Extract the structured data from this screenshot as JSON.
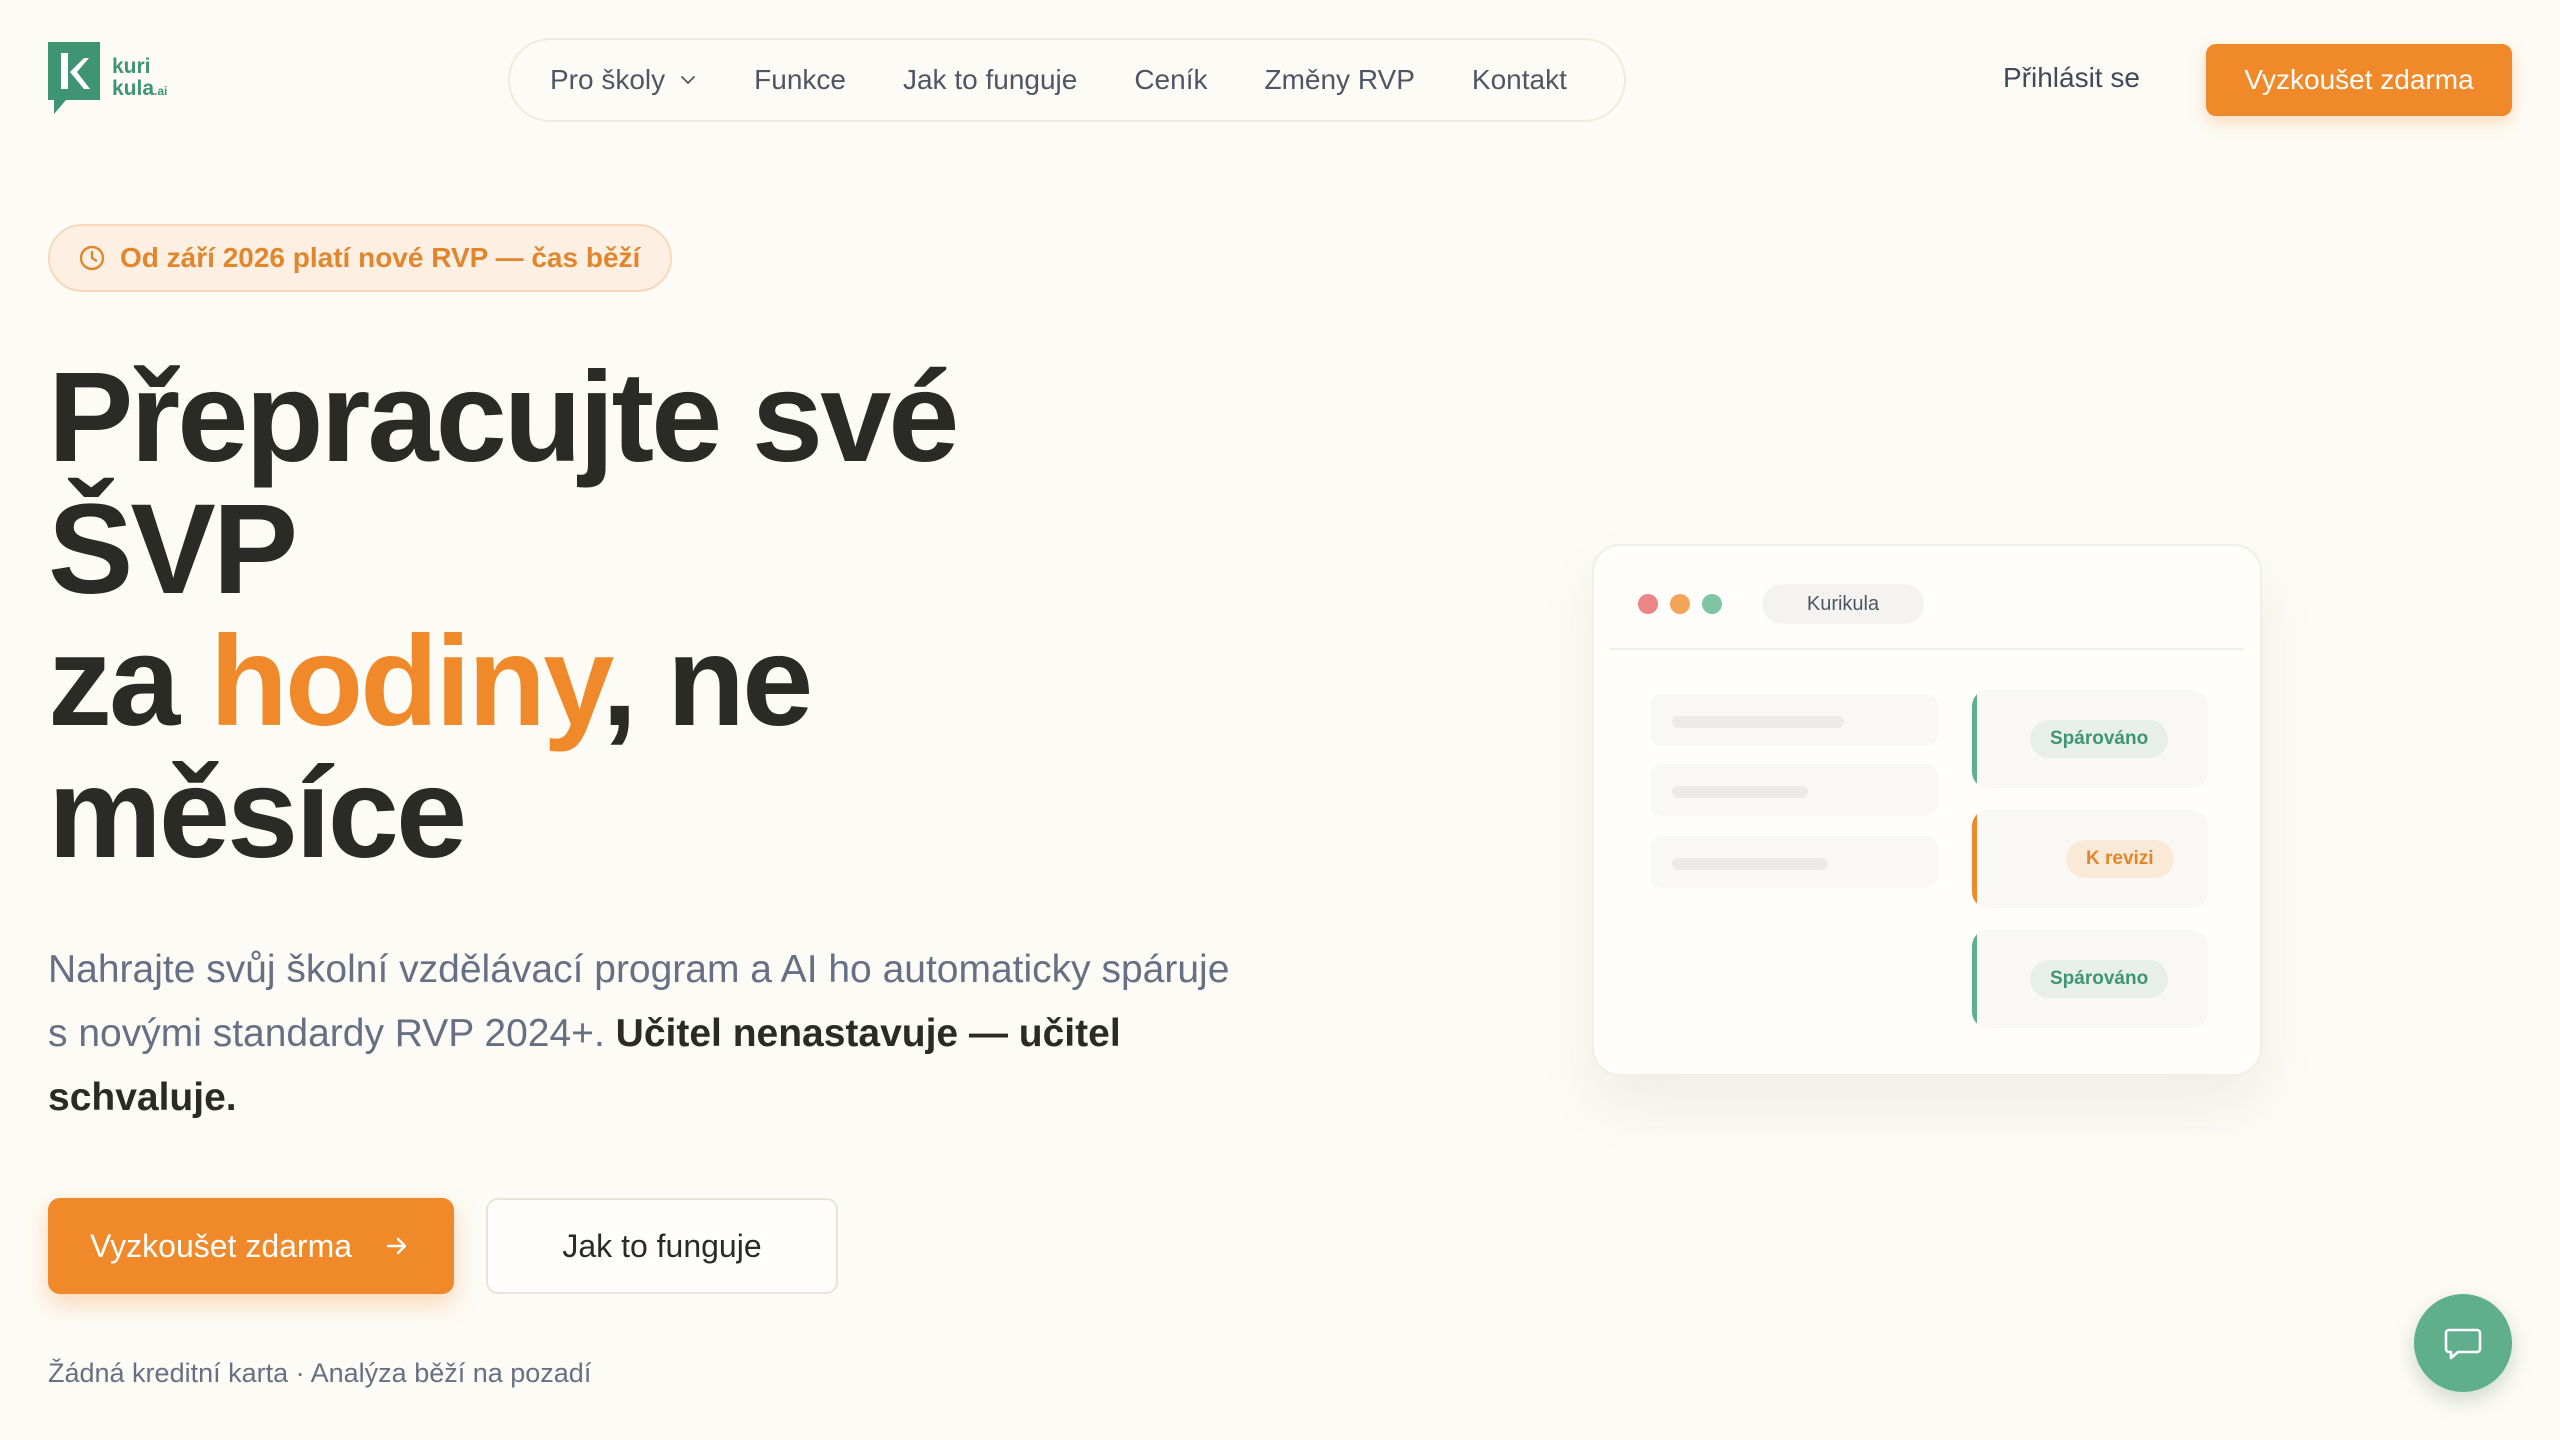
{
  "logo": {
    "line1": "kuri",
    "line2": "kula",
    "suffix": ".ai"
  },
  "nav": {
    "items": [
      {
        "label": "Pro školy",
        "has_dropdown": true
      },
      {
        "label": "Funkce"
      },
      {
        "label": "Jak to funguje"
      },
      {
        "label": "Ceník"
      },
      {
        "label": "Změny RVP"
      },
      {
        "label": "Kontakt"
      }
    ],
    "login_label": "Přihlásit se",
    "cta_label": "Vyzkoušet zdarma"
  },
  "hero": {
    "badge": "Od září 2026 platí nové RVP — čas běží",
    "headline": {
      "line1": "Přepracujte své",
      "line2": "ŠVP",
      "line3_prefix": "za ",
      "line3_accent": "hodiny",
      "line3_suffix": ", ne",
      "line4": "měsíce"
    },
    "subtitle_plain": "Nahrajte svůj školní vzdělávací program a AI ho automaticky spáruje s novými standardy RVP 2024+.",
    "subtitle_bold": "Učitel nenastavuje — učitel schvaluje.",
    "primary_cta": "Vyzkoušet zdarma",
    "secondary_cta": "Jak to funguje",
    "note": "Žádná kreditní karta · Analýza běží na pozadí"
  },
  "mockup": {
    "tab_label": "Kurikula",
    "window_dots": [
      "#ec8585",
      "#f2a55a",
      "#7fc4a4"
    ],
    "rows": [
      {
        "status": "Spárováno",
        "state": "matched"
      },
      {
        "status": "K revizi",
        "state": "review"
      },
      {
        "status": "Spárováno",
        "state": "matched"
      }
    ]
  },
  "colors": {
    "accent_orange": "#f0892a",
    "brand_green": "#3f9474",
    "chat_green": "#5fae8c",
    "background": "#fdfbf5"
  },
  "icons": {
    "badge": "clock-icon",
    "primary_cta": "arrow-right-icon",
    "chat": "chat-bubble-icon",
    "nav_dropdown": "chevron-down-icon"
  }
}
